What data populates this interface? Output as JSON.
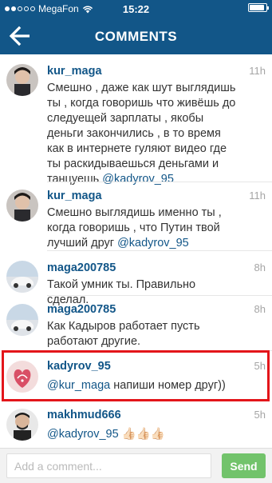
{
  "status_bar": {
    "carrier": "MegaFon",
    "time": "15:22"
  },
  "header": {
    "title": "COMMENTS"
  },
  "comments": [
    {
      "user": "kur_maga",
      "time": "11h",
      "text": "Смешно , даже как шут выглядишь ты , когда говоришь что живёшь до следуещей зарплаты , якобы деньги закончились , в то время как в интернете гуляют видео где ты раскидываешься деньгами и танцуешь ",
      "mention": "@kadyrov_95",
      "tail": ""
    },
    {
      "user": "kur_maga",
      "time": "11h",
      "text": "Смешно выглядишь именно ты , когда говоришь , что Путин твой лучший друг ",
      "mention": "@kadyrov_95",
      "tail": ""
    },
    {
      "user": "maga200785",
      "time": "8h",
      "text": "Такой умник ты. Правильно сделал.",
      "mention": "",
      "tail": ""
    },
    {
      "user": "maga200785",
      "time": "8h",
      "text": "Как Кадыров работает пусть работают другие.",
      "mention": "",
      "tail": ""
    },
    {
      "user": "kadyrov_95",
      "time": "5h",
      "text": "",
      "mention": "@kur_maga",
      "tail": " напиши номер друг))"
    },
    {
      "user": "makhmud666",
      "time": "5h",
      "text": "",
      "mention": "@kadyrov_95",
      "tail": " 👍🏻👍🏻👍🏻"
    }
  ],
  "footer": {
    "input_placeholder": "Add a comment...",
    "send_label": "Send"
  },
  "colors": {
    "brand_blue": "#125688",
    "send_green": "#72c36b",
    "highlight_red": "#e3151a"
  }
}
